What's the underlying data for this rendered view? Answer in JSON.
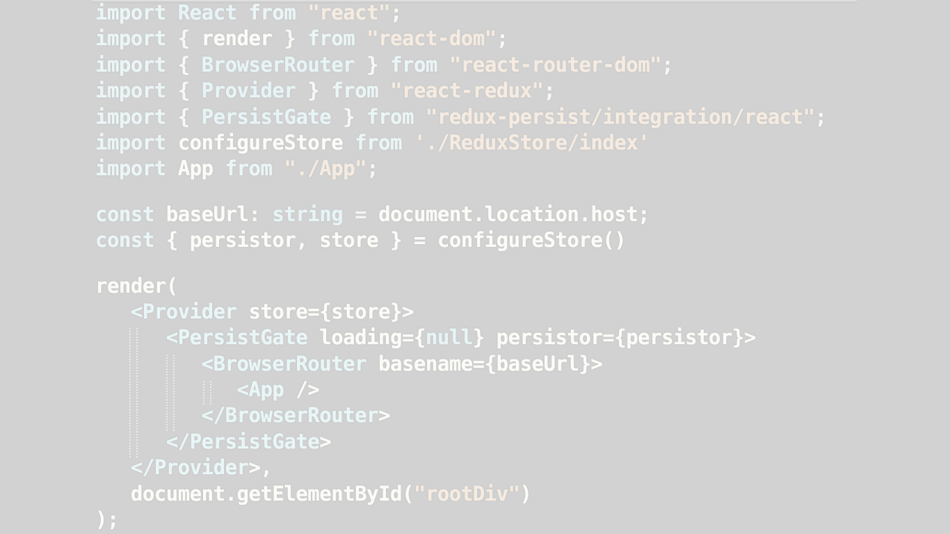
{
  "editor": {
    "lines": [
      [
        {
          "t": "import",
          "c": "kw"
        },
        {
          "t": " React ",
          "c": "type"
        },
        {
          "t": "from",
          "c": "kw"
        },
        {
          "t": " ",
          "c": "punc"
        },
        {
          "t": "\"react\"",
          "c": "str"
        },
        {
          "t": ";",
          "c": "punc"
        }
      ],
      [
        {
          "t": "import",
          "c": "kw"
        },
        {
          "t": " { ",
          "c": "punc"
        },
        {
          "t": "render",
          "c": "id"
        },
        {
          "t": " } ",
          "c": "punc"
        },
        {
          "t": "from",
          "c": "kw"
        },
        {
          "t": " ",
          "c": "punc"
        },
        {
          "t": "\"react-dom\"",
          "c": "str"
        },
        {
          "t": ";",
          "c": "punc"
        }
      ],
      [
        {
          "t": "import",
          "c": "kw"
        },
        {
          "t": " { ",
          "c": "punc"
        },
        {
          "t": "BrowserRouter",
          "c": "type"
        },
        {
          "t": " } ",
          "c": "punc"
        },
        {
          "t": "from",
          "c": "kw"
        },
        {
          "t": " ",
          "c": "punc"
        },
        {
          "t": "\"react-router-dom\"",
          "c": "str"
        },
        {
          "t": ";",
          "c": "punc"
        }
      ],
      [
        {
          "t": "import",
          "c": "kw"
        },
        {
          "t": " { ",
          "c": "punc"
        },
        {
          "t": "Provider",
          "c": "type"
        },
        {
          "t": " } ",
          "c": "punc"
        },
        {
          "t": "from",
          "c": "kw"
        },
        {
          "t": " ",
          "c": "punc"
        },
        {
          "t": "\"react-redux\"",
          "c": "str"
        },
        {
          "t": ";",
          "c": "punc"
        }
      ],
      [
        {
          "t": "import",
          "c": "kw"
        },
        {
          "t": " { ",
          "c": "punc"
        },
        {
          "t": "PersistGate",
          "c": "type"
        },
        {
          "t": " } ",
          "c": "punc"
        },
        {
          "t": "from",
          "c": "kw"
        },
        {
          "t": " ",
          "c": "punc"
        },
        {
          "t": "\"redux-persist/integration/react\"",
          "c": "str"
        },
        {
          "t": ";",
          "c": "punc"
        }
      ],
      [
        {
          "t": "import",
          "c": "kw"
        },
        {
          "t": " configureStore ",
          "c": "id"
        },
        {
          "t": "from",
          "c": "kw"
        },
        {
          "t": " ",
          "c": "punc"
        },
        {
          "t": "'./ReduxStore/index'",
          "c": "str"
        }
      ],
      [
        {
          "t": "import",
          "c": "kw"
        },
        {
          "t": " App ",
          "c": "id"
        },
        {
          "t": "from",
          "c": "kw"
        },
        {
          "t": " ",
          "c": "punc"
        },
        {
          "t": "\"./App\"",
          "c": "str"
        },
        {
          "t": ";",
          "c": "punc"
        }
      ],
      null,
      [
        {
          "t": "const",
          "c": "kw"
        },
        {
          "t": " baseUrl",
          "c": "id"
        },
        {
          "t": ": ",
          "c": "punc"
        },
        {
          "t": "string",
          "c": "type"
        },
        {
          "t": " = ",
          "c": "op"
        },
        {
          "t": "document.location.host;",
          "c": "id"
        }
      ],
      [
        {
          "t": "const",
          "c": "kw"
        },
        {
          "t": " { persistor, store } = configureStore()",
          "c": "id"
        }
      ],
      null,
      [
        {
          "t": "render(",
          "c": "id"
        }
      ],
      [
        {
          "t": "   <",
          "c": "tag"
        },
        {
          "t": "Provider",
          "c": "tag"
        },
        {
          "t": " store={store}>",
          "c": "id"
        }
      ],
      [
        {
          "t": "      <",
          "c": "tag"
        },
        {
          "t": "PersistGate",
          "c": "tag"
        },
        {
          "t": " loading={",
          "c": "id"
        },
        {
          "t": "null",
          "c": "type"
        },
        {
          "t": "} persistor={persistor}>",
          "c": "id"
        }
      ],
      [
        {
          "t": "         <",
          "c": "tag"
        },
        {
          "t": "BrowserRouter",
          "c": "tag"
        },
        {
          "t": " basename={baseUrl}>",
          "c": "id"
        }
      ],
      [
        {
          "t": "            <",
          "c": "tag"
        },
        {
          "t": "App",
          "c": "tag"
        },
        {
          "t": " />",
          "c": "id"
        }
      ],
      [
        {
          "t": "         </",
          "c": "tag"
        },
        {
          "t": "BrowserRouter",
          "c": "tag"
        },
        {
          "t": ">",
          "c": "id"
        }
      ],
      [
        {
          "t": "      </",
          "c": "tag"
        },
        {
          "t": "PersistGate",
          "c": "tag"
        },
        {
          "t": ">",
          "c": "id"
        }
      ],
      [
        {
          "t": "   </",
          "c": "tag"
        },
        {
          "t": "Provider",
          "c": "tag"
        },
        {
          "t": ">,",
          "c": "id"
        }
      ],
      [
        {
          "t": "   document.getElementById(",
          "c": "id"
        },
        {
          "t": "\"rootDiv\"",
          "c": "str"
        },
        {
          "t": ")",
          "c": "id"
        }
      ],
      [
        {
          "t": ");",
          "c": "id"
        }
      ]
    ]
  },
  "colors": {
    "background": "#d2d2d2",
    "keyword": "#eaf5f6",
    "string": "#f6ebe0",
    "identifier": "#fbfbf7"
  }
}
